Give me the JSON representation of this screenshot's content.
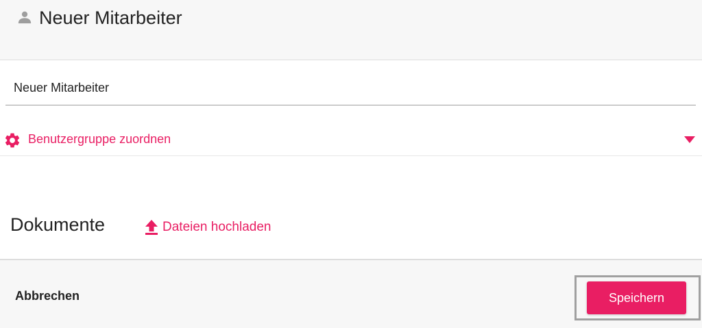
{
  "header": {
    "title": "Neuer Mitarbeiter",
    "icon": "person-icon"
  },
  "form": {
    "name_value": "Neuer Mitarbeiter"
  },
  "group_section": {
    "label": "Benutzergruppe zuordnen",
    "icon": "gear-icon",
    "toggle_icon": "caret-down-icon"
  },
  "documents": {
    "title": "Dokumente",
    "upload_label": "Dateien hochladen",
    "upload_icon": "upload-icon"
  },
  "footer": {
    "cancel_label": "Abbrechen",
    "save_label": "Speichern"
  },
  "colors": {
    "accent": "#e91e63",
    "header_bg": "#f7f7f7",
    "text": "#222222"
  }
}
